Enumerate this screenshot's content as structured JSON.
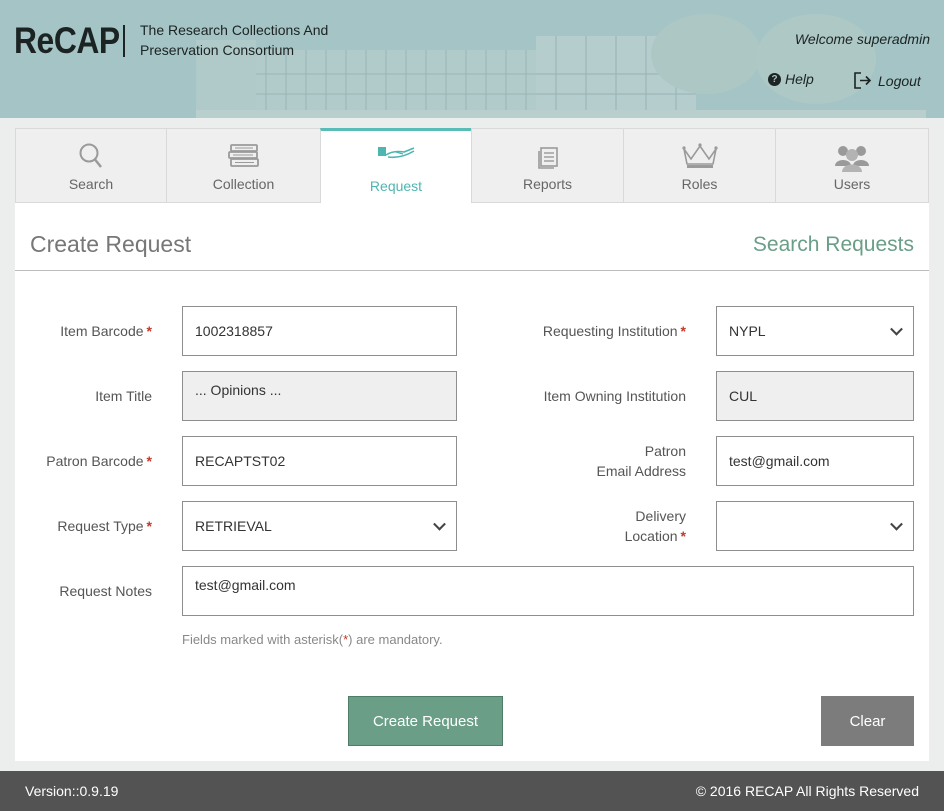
{
  "header": {
    "logo": "ReCAP",
    "tagline_line1": "The Research Collections And",
    "tagline_line2": "Preservation Consortium",
    "welcome": "Welcome superadmin",
    "help": "Help",
    "logout": "Logout"
  },
  "tabs": [
    {
      "label": "Search",
      "icon": "search-icon"
    },
    {
      "label": "Collection",
      "icon": "books-icon"
    },
    {
      "label": "Request",
      "icon": "hand-book-icon",
      "active": true
    },
    {
      "label": "Reports",
      "icon": "document-icon"
    },
    {
      "label": "Roles",
      "icon": "crown-icon"
    },
    {
      "label": "Users",
      "icon": "users-icon"
    }
  ],
  "page": {
    "title": "Create Request",
    "search_requests": "Search Requests"
  },
  "form": {
    "item_barcode_label": "Item Barcode",
    "item_barcode_value": "1002318857",
    "item_title_label": "Item Title",
    "item_title_value": "... Opinions ...",
    "patron_barcode_label": "Patron Barcode",
    "patron_barcode_value": "RECAPTST02",
    "request_type_label": "Request Type",
    "request_type_value": "RETRIEVAL",
    "request_notes_label": "Request Notes",
    "request_notes_value": "test@gmail.com",
    "requesting_institution_label": "Requesting Institution",
    "requesting_institution_value": "NYPL",
    "owning_institution_label": "Item Owning Institution",
    "owning_institution_value": "CUL",
    "patron_email_label_line1": "Patron",
    "patron_email_label_line2": "Email Address",
    "patron_email_value": "test@gmail.com",
    "delivery_location_label_line1": "Delivery",
    "delivery_location_label_line2": "Location",
    "delivery_location_value": "",
    "required_marker": "*",
    "note_prefix": "Fields marked with asterisk(",
    "note_star": "*",
    "note_suffix": ") are mandatory."
  },
  "buttons": {
    "create": "Create Request",
    "clear": "Clear"
  },
  "footer": {
    "version": "Version::0.9.19",
    "copyright": "© 2016 RECAP All Rights Reserved"
  },
  "colors": {
    "accent": "#59bcb7",
    "primary_button": "#6a9e87",
    "header_bg": "#a5c4c5",
    "footer_bg": "#535353",
    "required": "#c0392b"
  }
}
